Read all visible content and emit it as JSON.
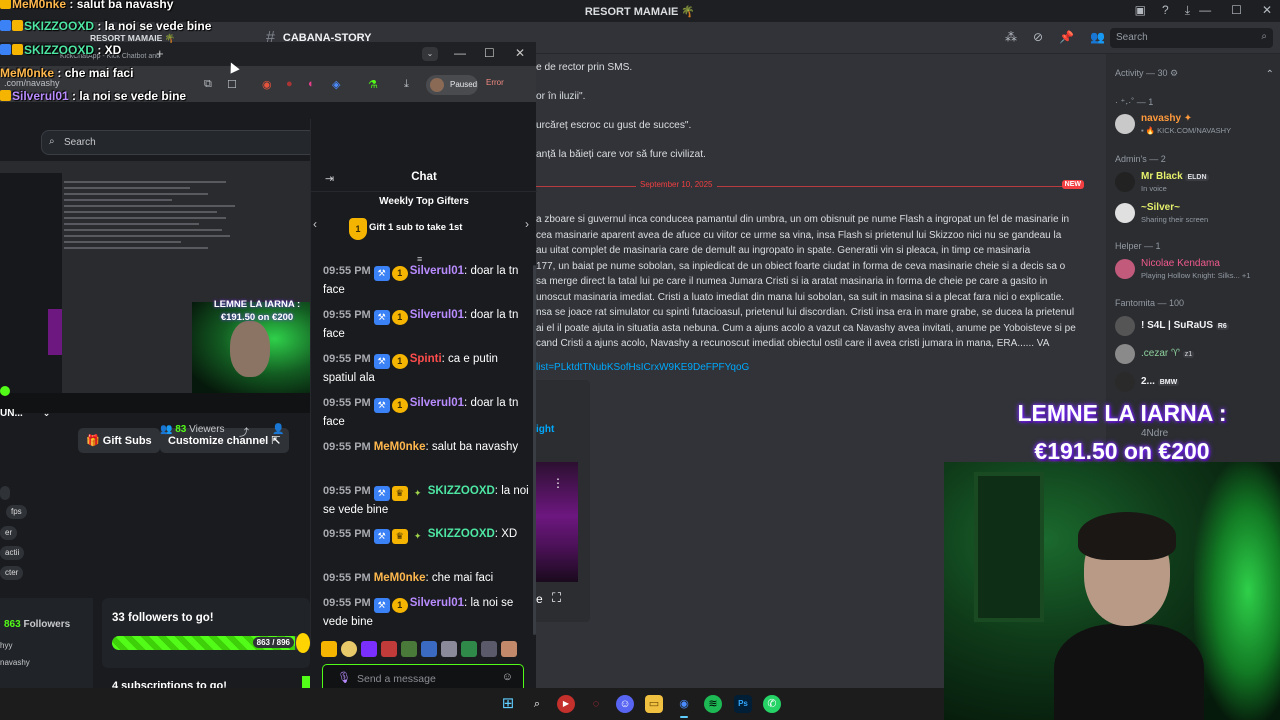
{
  "discord": {
    "server_title": "RESORT MAMAIE 🌴",
    "channel_name": "CABANA-STORY",
    "search_placeholder": "Search",
    "messages": [
      "e de rector prin SMS.",
      "or în iluzii\".",
      "urcăreț escroc cu gust de succes\".",
      "anță la băieți care vor să fure civilizat."
    ],
    "date_divider": "September 10, 2025",
    "new_label": "NEW",
    "story_lines": [
      "a zboare si guvernul inca conducea pamantul din umbra, un om obisnuit pe nume Flash a ingropat un fel de masinarie in",
      "cea masinarie aparent avea de afuce cu viitor ce urme sa vina, insa Flash si prietenul lui Skizzoo nici nu se gandeau la",
      "au uitat complet de masinaria care de demult au ingropato in spate. Generatii vin si pleaca, in timp ce masinaria",
      "177, un baiat pe nume sobolan, sa inpiedicat de un obiect foarte ciudat in forma de ceva masinarie cheie si a decis sa o",
      "sa merge direct la tatal lui pe care il numea Jumara Cristi si ia aratat masinaria in forma de cheie pe care a gasito in",
      "unoscut masinaria imediat. Cristi a luato imediat din mana lui sobolan, sa suit in masina si a plecat fara nici o explicatie.",
      "nsa se joace rat simulator cu spinti futacioasul, prietenul lui discordian. Cristi insa era in mare grabe, se ducea la prietenul",
      "ai el il poate ajuta in situatia asta nebuna. Cum a ajuns acolo a vazut ca Navashy avea invitati, anume pe Yoboisteve si pe",
      " cand Cristi a ajuns acolo, Navashy a recunoscut imediat obiectul ostil care il avea cristi jumara in mana, ERA...... VA"
    ],
    "link_text": "list=PLktdtTNubKSofHsICrxW9KE9DeFPFYqoG",
    "embed_title": "ight",
    "members": {
      "activity": "Activity — 30 ⚙",
      "cat_a": "· ⁺˖·˚ — 1",
      "m1_name": "navashy ✦",
      "m1_sub": "▪ 🔥 KICK.COM/NAVASHY",
      "admins": "Admin's — 2",
      "m2_name": "Mr Black",
      "m2_tag": "ELDN",
      "m2_sub": "In voice",
      "m3_name": "~Silver~",
      "m3_sub": "Sharing their screen",
      "helper": "Helper — 1",
      "m4_name": "Nicolae Kendama",
      "m4_sub": "Playing Hollow Knight: Silks...",
      "m4_extra": "+1",
      "fantomita": "Fantomita — 100",
      "m5_name": "! S4L | SuRaUS",
      "m5_tag": "R6",
      "m6_name": ".cezar ♈",
      "m6_tag": "z1",
      "m7_name": "2...",
      "m7_tag": "BMW",
      "m8_name": "4Ndre"
    }
  },
  "overlay": {
    "goal_line1": "LEMNE LA IARNA :",
    "goal_line2": "€191.50 on €200",
    "chat_lines": [
      {
        "user": "MeM0nke",
        "text": " : salut ba navashy",
        "color": "#ffb84d"
      },
      {
        "user": "SKIZZOOXD",
        "text": " : la noi se vede bine",
        "color": "#4ee6a3"
      },
      {
        "user": "SKIZZOOXD",
        "text": " : XD",
        "color": "#4ee6a3"
      },
      {
        "user": "MeM0nke",
        "text": " : che mai faci",
        "color": "#ffb84d"
      },
      {
        "user": "Silverul01",
        "text": " : la noi se vede bine",
        "color": "#b98cff"
      }
    ],
    "bg_title": "RESORT MAMAIE 🌴"
  },
  "kick": {
    "tab_title": "KickChatApp - Kick Chatbot and",
    "url": ".com/navashy",
    "paused_label": "Paused",
    "error_label": "Error",
    "search_placeholder": "Search",
    "preview_goal": "LEMNE LA IARNA : €191.50 on €200",
    "channel_short": "UN...",
    "gift_subs": "Gift Subs",
    "customize": "Customize channel",
    "viewers_count": "83",
    "viewers_label": " Viewers",
    "tags": [
      "",
      "fps",
      "er",
      "actii",
      "cter"
    ],
    "followers_count": "863",
    "followers_label": " Followers",
    "follower_1": "hyy",
    "follower_2": "navashy",
    "goal_title": "33 followers to go!",
    "goal_label": "863 / 896",
    "goal_fraction": 0.963,
    "subs_title": "4 subscriptions to go!",
    "chat": {
      "title": "Chat",
      "gifters_title": "Weekly Top Gifters",
      "gifters_cta": "Gift 1 sub to take 1st",
      "input_placeholder": "Send a message",
      "messages": [
        {
          "time": "09:55 PM",
          "user": "Silverul01",
          "color": "#b98cff",
          "badges": [
            "mod",
            "sub"
          ],
          "text": "doar la tn face"
        },
        {
          "time": "09:55 PM",
          "user": "Silverul01",
          "color": "#b98cff",
          "badges": [
            "mod",
            "sub"
          ],
          "text": "doar la tn face"
        },
        {
          "time": "09:55 PM",
          "user": "Spinti",
          "color": "#ff4d4d",
          "badges": [
            "mod",
            "sub"
          ],
          "text": "ca e putin spatiul ala"
        },
        {
          "time": "09:55 PM",
          "user": "Silverul01",
          "color": "#b98cff",
          "badges": [
            "mod",
            "sub"
          ],
          "text": "doar la tn face"
        },
        {
          "time": "09:55 PM",
          "user": "MeM0nke",
          "color": "#ffb84d",
          "badges": [],
          "text": "salut ba navashy"
        },
        {
          "time": "09:55 PM",
          "user": "SKIZZOOXD",
          "color": "#4ee6a3",
          "badges": [
            "mod",
            "crown",
            "og"
          ],
          "text": "la noi se vede bine"
        },
        {
          "time": "09:55 PM",
          "user": "SKIZZOOXD",
          "color": "#4ee6a3",
          "badges": [
            "mod",
            "crown",
            "og"
          ],
          "text": "XD"
        },
        {
          "time": "09:55 PM",
          "user": "MeM0nke",
          "color": "#ffb84d",
          "badges": [],
          "text": "che mai faci"
        },
        {
          "time": "09:55 PM",
          "user": "Silverul01",
          "color": "#b98cff",
          "badges": [
            "mod",
            "sub"
          ],
          "text": "la noi se vede bine"
        }
      ]
    }
  },
  "colors": {
    "kick_green": "#53fc18",
    "discord_bg": "#313338",
    "kick_bg": "#191b1f"
  }
}
